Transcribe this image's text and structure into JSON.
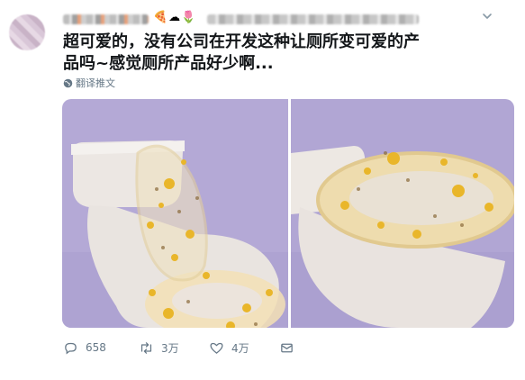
{
  "header": {
    "name_censored": true,
    "emojis": "🍕☁🌷",
    "handle_censored": true
  },
  "tweet": {
    "text_line1": "超可爱的，没有公司在开发这种让厕所变可爱的产",
    "text_line2": "品吗~感觉厕所产品好少啊...",
    "translate_label": "翻译推文"
  },
  "media": [
    {
      "description": "clear resin toilet seat with pressed flowers, lid open"
    },
    {
      "description": "clear resin toilet seat with pressed flowers, close-up"
    }
  ],
  "actions": {
    "reply_count": "658",
    "retweet_count": "3万",
    "like_count": "4万"
  },
  "colors": {
    "text": "#14171a",
    "secondary": "#657786",
    "wall": "#b4a9d6"
  }
}
